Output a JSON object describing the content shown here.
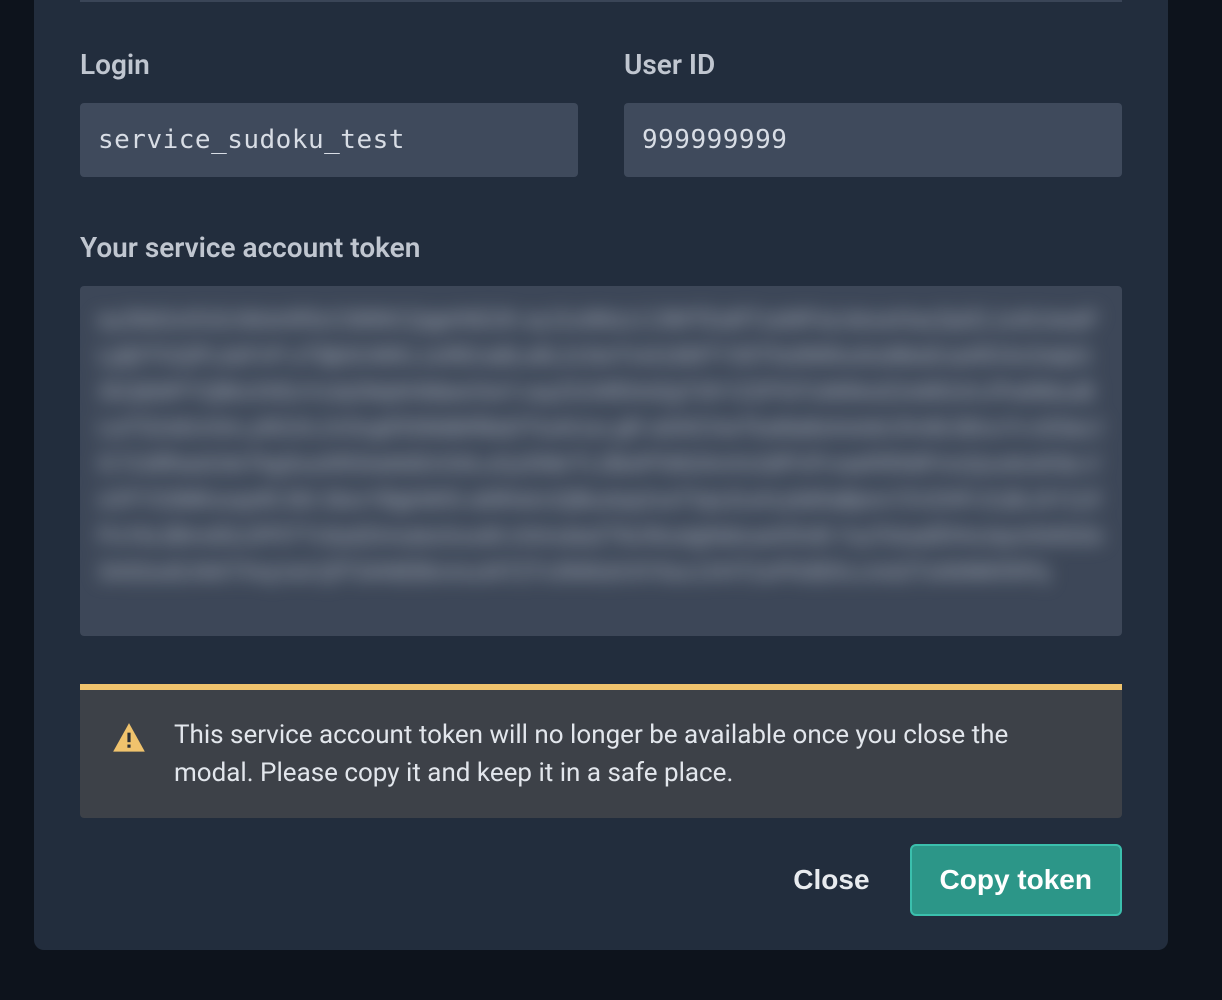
{
  "fields": {
    "login": {
      "label": "Login",
      "value": "service_sudoku_test"
    },
    "user_id": {
      "label": "User ID",
      "value": "999999999"
    }
  },
  "token": {
    "label": "Your service account token",
    "blurred_placeholder": "eyJhbGciOiJLNiIsInR5cCI6IlNCQqpHhE2K.eyJ1uWkzLCJlWTEaRTzaWFaLlskxaXIazZpiZL1oAUseaPLyljDTGQPLdoFvP:uT9jk0UWKL1oREna8La9L2cSwTmA16MTY30T5st9Wfus5uMbsExaAfG3cZwtpI13G2jNIIPYQBIz3XEoYu3yDbIjAHldtanOwY.vayZG34fDInlZgT2KYZZPSITulWIkxlZ2oMG2rLIPwtIMuuBLwTS2xEoVtm,y9G2rL2nSvgIf3S6ldbRBaDTtuAUus.gR-aIIAIChwTkaIlta8sAxlxttrJHv8LfdInu7n:s03acJIC7LWfhas5JtoTkgSusAfISAafs82nS4LuGySNkrTL2BoiPSI62AnXn2dPUFrvaeRIRdIFmzQuxdvsK9a.VoVFYS3MKoxqnf0.5Kl.SksrYBghWIS-aNRolcUQBuslxp2vaTXpLEuA1yfaRaBjmn72VZHFrJI:j9L2tY1UfPuYkLIBInvElLDP5TTv0ydZimsalurlzuoi6:chImubaZTtkJNcaIgNdouartISvB.YuyTckaafDHoJaymhtA02e3n02oufLKkKTHuj:lvd:QfTSANEBIcmcuNTZTv3NNIzll:6Y0uc1XHT2uPN3EKLrcIsIZTuNIIMKRIPq"
  },
  "warning": {
    "text": "This service account token will no longer be available once you close the modal. Please copy it and keep it in a safe place.",
    "icon": "warning-triangle"
  },
  "actions": {
    "close_label": "Close",
    "copy_label": "Copy token"
  },
  "colors": {
    "modal_bg": "#222d3d",
    "input_bg": "#3f4a5c",
    "warning_bar": "#f0c36d",
    "primary_btn": "#2c9688"
  }
}
